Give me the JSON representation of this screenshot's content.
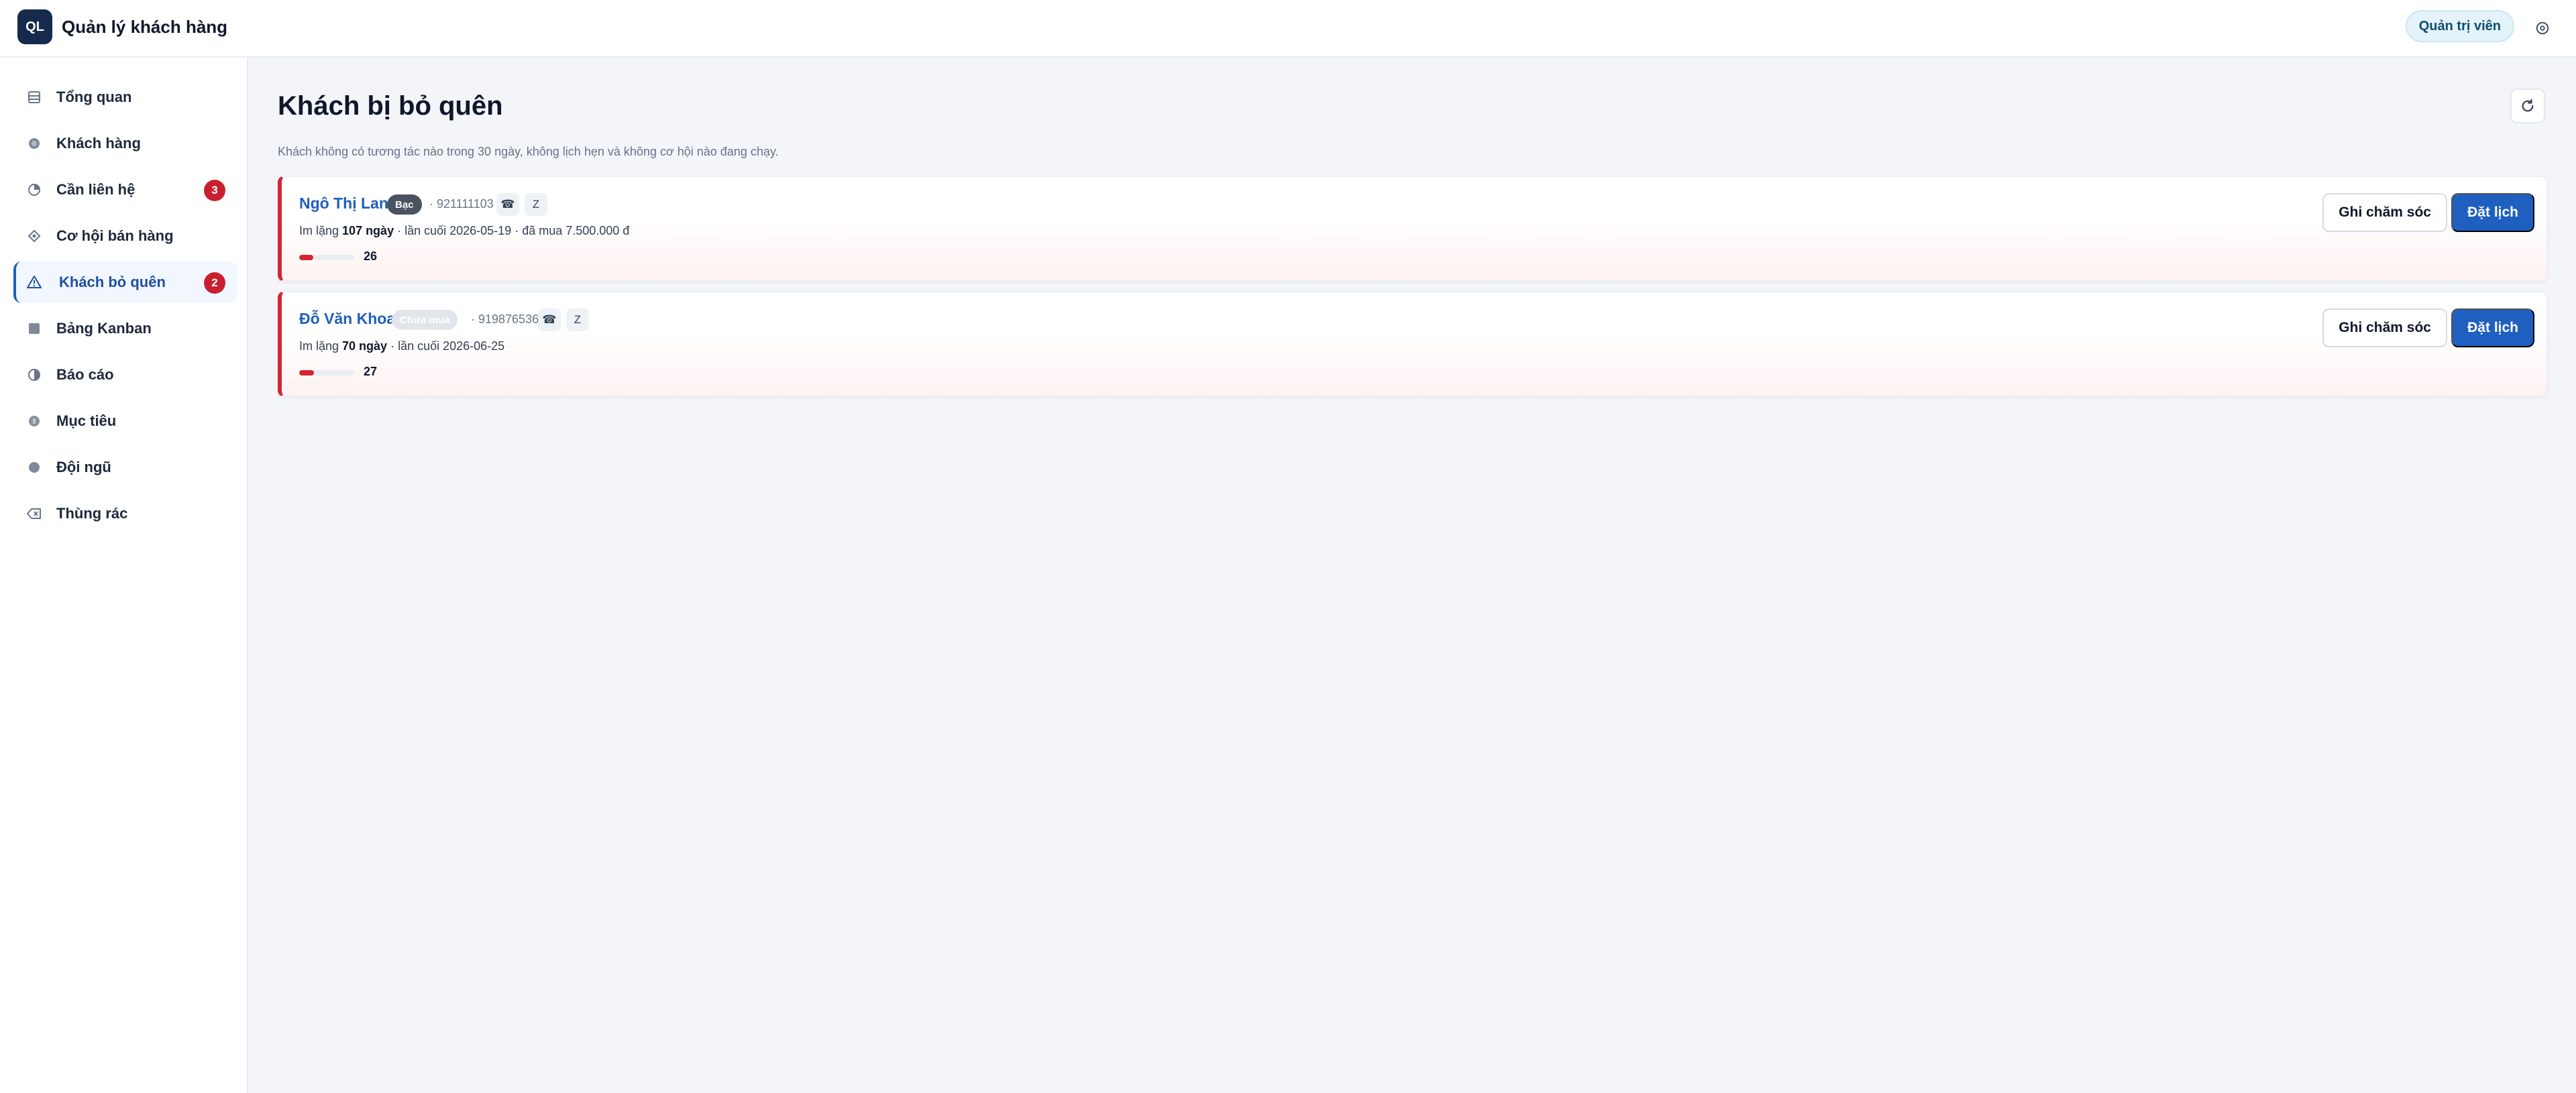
{
  "app": {
    "logo_text": "QL",
    "title": "Quản lý khách hàng"
  },
  "header": {
    "role": "Quản trị viên"
  },
  "sidebar": {
    "items": [
      {
        "label": "Tổng quan",
        "icon": "grid-icon"
      },
      {
        "label": "Khách hàng",
        "icon": "users-icon"
      },
      {
        "label": "Cần liên hệ",
        "icon": "clock-icon",
        "badge": "3"
      },
      {
        "label": "Cơ hội bán hàng",
        "icon": "target-icon"
      },
      {
        "label": "Khách bỏ quên",
        "icon": "warning-icon",
        "badge": "2",
        "active": true
      },
      {
        "label": "Bảng Kanban",
        "icon": "kanban-icon"
      },
      {
        "label": "Báo cáo",
        "icon": "chart-icon"
      },
      {
        "label": "Mục tiêu",
        "icon": "goal-icon"
      },
      {
        "label": "Đội ngũ",
        "icon": "team-icon"
      },
      {
        "label": "Thùng rác",
        "icon": "trash-icon"
      }
    ]
  },
  "main": {
    "title": "Khách bị bỏ quên",
    "subtitle": "Khách không có tương tác nào trong 30 ngày, không lịch hẹn và không cơ hội nào đang chạy.",
    "customers": [
      {
        "name": "Ngô Thị Lan",
        "tier": "Bạc",
        "phone": "· 921111103",
        "chip_call": "☎",
        "chip_zalo": "Z",
        "meta_prefix": "Im lặng ",
        "silent_days": "107 ngày",
        "meta_suffix": " · lần cuối 2026-05-19 · đã mua 7.500.000 đ",
        "score": "26",
        "btn_care": "Ghi chăm sóc",
        "btn_book": "Đặt lịch"
      },
      {
        "name": "Đỗ Văn Khoa",
        "tier": "Chưa mua",
        "phone": "· 919876536",
        "chip_call": "☎",
        "chip_zalo": "Z",
        "meta_prefix": "Im lặng ",
        "silent_days": "70 ngày",
        "meta_suffix": " · lần cuối 2026-06-25",
        "score": "27",
        "btn_care": "Ghi chăm sóc",
        "btn_book": "Đặt lịch"
      }
    ]
  },
  "colors": {
    "accent": "#1f5fbf",
    "danger": "#d42631",
    "navy": "#152a4d"
  }
}
